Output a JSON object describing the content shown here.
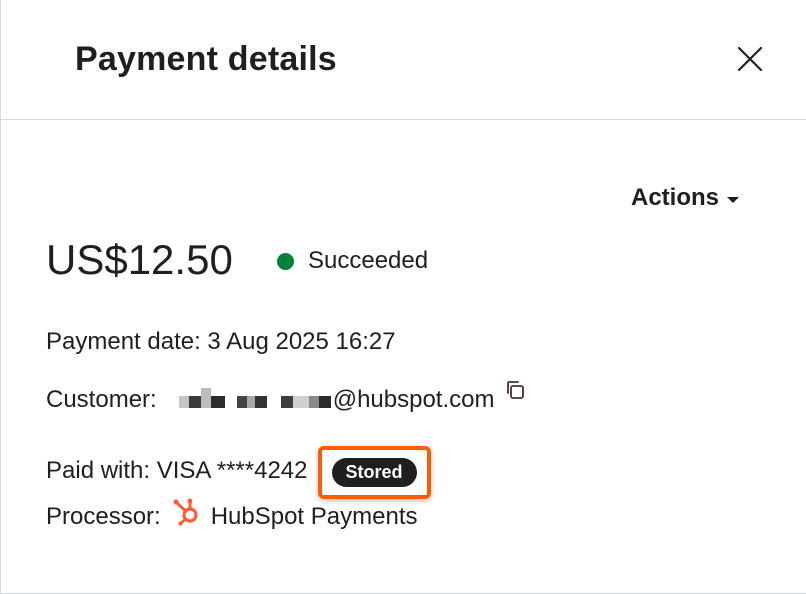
{
  "panel": {
    "title": "Payment details",
    "close_icon": "close-icon"
  },
  "actions": {
    "label": "Actions",
    "icon": "caret-down-icon"
  },
  "payment": {
    "amount": "US$12.50",
    "status": "Succeeded",
    "status_color": "#00823b"
  },
  "details": {
    "date_label": "Payment date: 3 Aug 2025 16:27",
    "customer_label": "Customer:",
    "customer_email_suffix": "@hubspot.com",
    "copy_icon": "copy-icon",
    "paid_with": "Paid with: VISA ****4242",
    "stored_badge": "Stored",
    "highlight_color": "#ff5c00",
    "processor_label": "Processor:",
    "processor_name": "HubSpot Payments",
    "processor_icon": "hubspot-sprocket-icon",
    "brand_color": "#ff5c35"
  }
}
